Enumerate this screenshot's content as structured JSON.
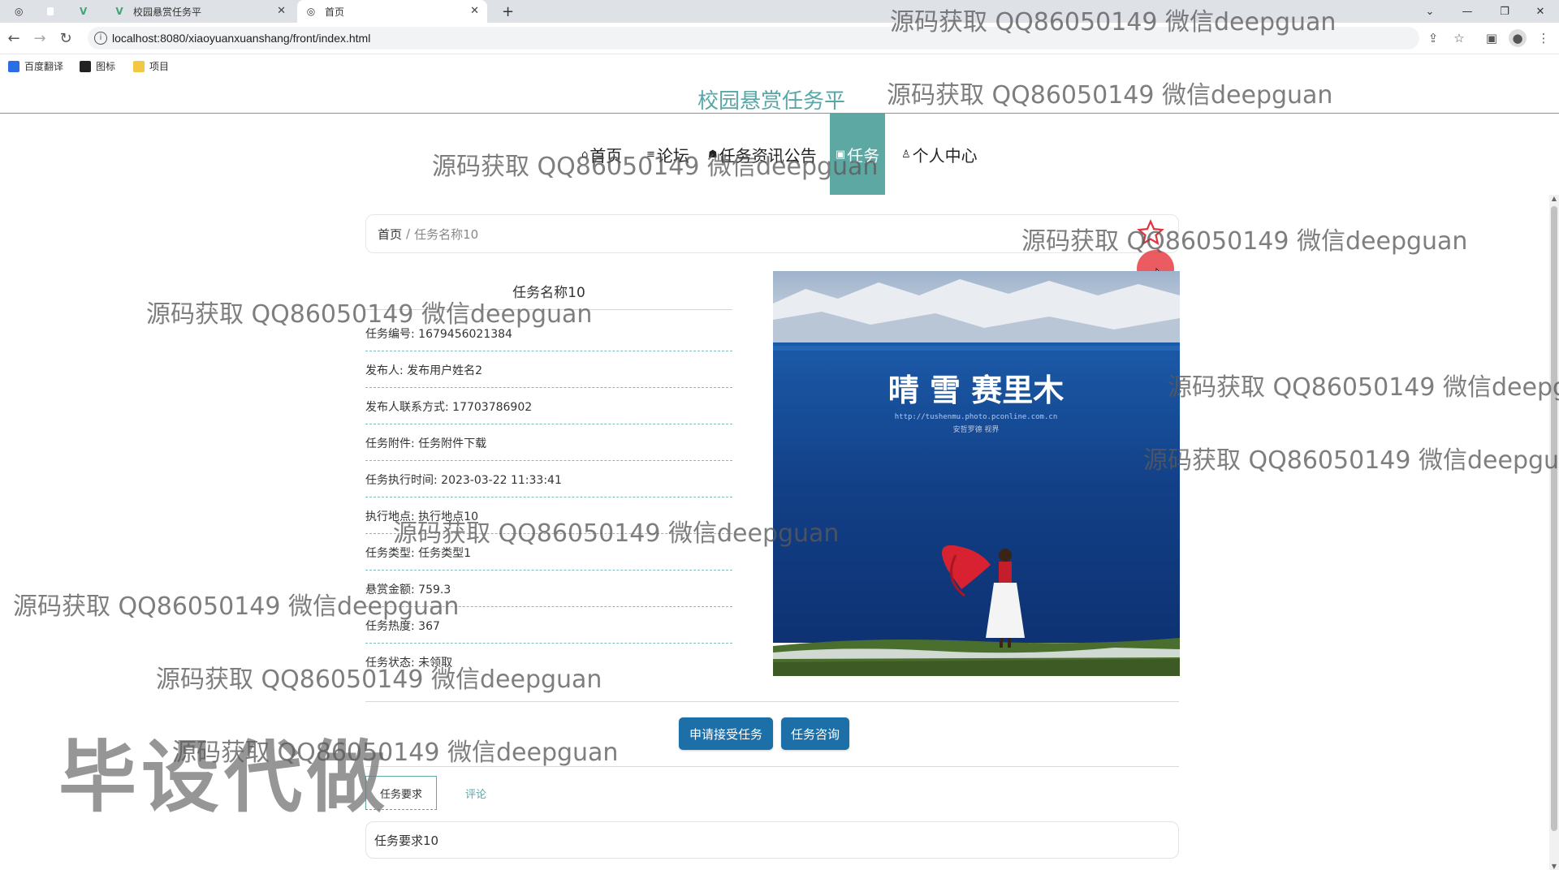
{
  "browser": {
    "tabs": [
      {
        "label": "",
        "active": false
      },
      {
        "label": "",
        "active": false
      },
      {
        "label": "",
        "active": false
      },
      {
        "label": "校园悬赏任务平",
        "active": false
      },
      {
        "label": "首页",
        "active": true
      }
    ],
    "new_tab": "+",
    "url": "localhost:8080/xiaoyuanxuanshang/front/index.html",
    "bookmarks": [
      {
        "label": "百度翻译",
        "color": "#2b6de4"
      },
      {
        "label": "图标",
        "color": "#222222"
      },
      {
        "label": "项目",
        "color": "#f2c744"
      }
    ]
  },
  "site": {
    "title": "校园悬赏任务平",
    "accent_color": "#5ea8a4",
    "nav": [
      {
        "icon": "home-icon",
        "glyph": "⌂",
        "label": "首页"
      },
      {
        "icon": "forum-icon",
        "glyph": "≡",
        "label": "论坛"
      },
      {
        "icon": "graduation-cap-icon",
        "glyph": "☗",
        "label": "任务资讯公告"
      },
      {
        "icon": "task-icon",
        "glyph": "▣",
        "label": "任务"
      },
      {
        "icon": "user-icon",
        "glyph": "♙",
        "label": "个人中心"
      }
    ]
  },
  "breadcrumb": {
    "home": "首页",
    "separator": "/",
    "current": "任务名称10"
  },
  "detail": {
    "name": "任务名称10",
    "fields": [
      "任务编号: 1679456021384",
      "发布人: 发布用户姓名2",
      "发布人联系方式: 17703786902",
      "任务附件: 任务附件下载",
      "任务执行时间: 2023-03-22 11:33:41",
      "执行地点: 执行地点10",
      "任务类型: 任务类型1",
      "悬赏金额: 759.3",
      "任务热度: 367",
      "任务状态: 未领取"
    ],
    "photo": {
      "logo": "晴 雪 赛里木",
      "url_text": "http://tushenmu.photo.pconline.com.cn",
      "caption": "安哲罗德 视界"
    }
  },
  "actions": {
    "apply": "申请接受任务",
    "consult": "任务咨询",
    "color": "#1d6fa8"
  },
  "tabs": {
    "requirements": "任务要求",
    "comments": "评论"
  },
  "requirements_text": "任务要求10",
  "watermarks": {
    "text": "源码获取 QQ86050149 微信deepguan",
    "text_cut_1": "源码获取 QQ86050149 微信deepg",
    "text_cut_2": "源码获取 QQ86050149 微信deepgua",
    "big": "毕设代做"
  }
}
